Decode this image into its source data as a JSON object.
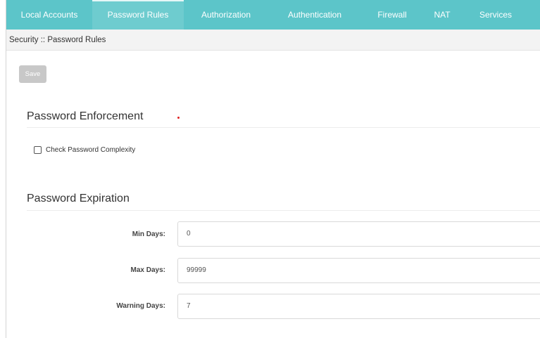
{
  "tabs": [
    {
      "label": "Local Accounts",
      "active": false
    },
    {
      "label": "Password Rules",
      "active": true
    },
    {
      "label": "Authorization",
      "active": false
    },
    {
      "label": "Authentication",
      "active": false
    },
    {
      "label": "Firewall",
      "active": false
    },
    {
      "label": "NAT",
      "active": false
    },
    {
      "label": "Services",
      "active": false
    }
  ],
  "breadcrumb": "Security :: Password Rules",
  "toolbar": {
    "save_label": "Save"
  },
  "enforcement": {
    "title": "Password Enforcement",
    "check_complexity": {
      "label": "Check Password Complexity",
      "checked": false
    }
  },
  "expiration": {
    "title": "Password Expiration",
    "fields": [
      {
        "label": "Min Days:",
        "value": "0"
      },
      {
        "label": "Max Days:",
        "value": "99999"
      },
      {
        "label": "Warning Days:",
        "value": "7"
      }
    ]
  },
  "colors": {
    "tabbar": "#5cc5c9",
    "tab_active": "#6ecccf",
    "save_button": "#c8c8c8",
    "required_dot": "#e02020"
  }
}
